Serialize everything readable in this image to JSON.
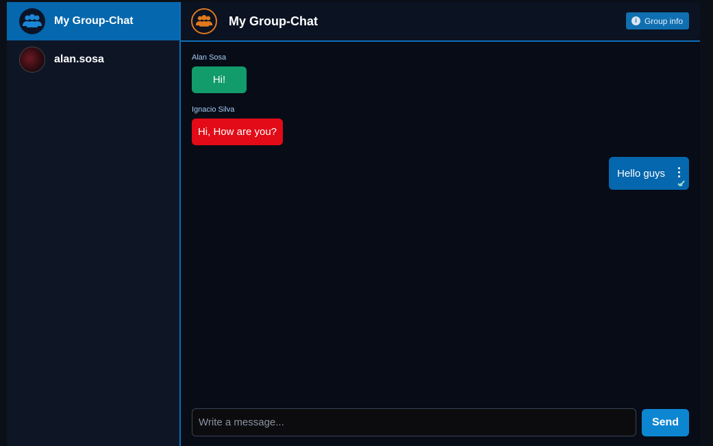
{
  "sidebar": {
    "items": [
      {
        "label": "My Group-Chat",
        "icon": "users-icon",
        "active": true
      },
      {
        "label": "alan.sosa",
        "icon": "avatar-photo",
        "active": false
      }
    ]
  },
  "header": {
    "title": "My Group-Chat",
    "group_info_label": "Group info"
  },
  "messages": [
    {
      "sender": "Alan Sosa",
      "text": "Hi!",
      "color": "#129c6b"
    },
    {
      "sender": "Ignacio Silva",
      "text": "Hi, How are you?",
      "color": "#e20b17"
    },
    {
      "sender": "",
      "text": "Hello guys",
      "color": "#0567ad",
      "own": true
    }
  ],
  "composer": {
    "placeholder": "Write a message...",
    "send_label": "Send"
  },
  "colors": {
    "accent": "#0567ad",
    "header_icon": "#e0791e"
  }
}
